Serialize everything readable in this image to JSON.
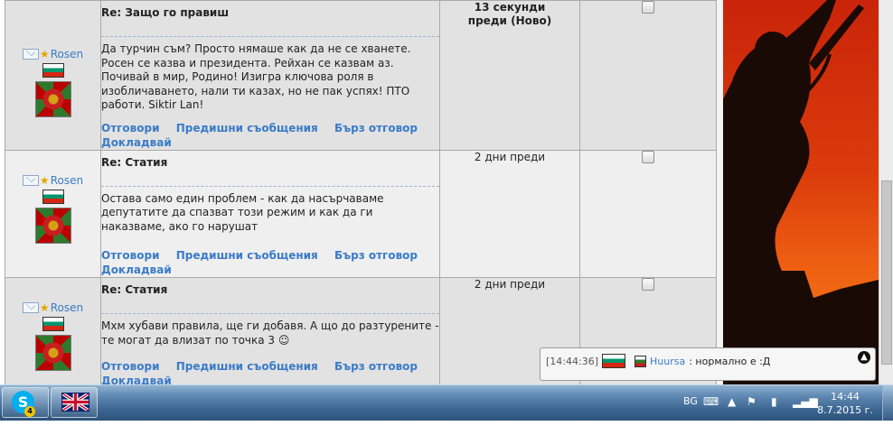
{
  "posts": [
    {
      "username": "Rosen",
      "subject": "Re: Защо го правиш",
      "body": "Да турчин съм? Просто нямаше как да не се хванете. Росен се казва и президента. Рейхан се казвам аз. Почивай в мир, Родино! Изигра ключова роля в изобличаването, нали ти казах, но не пак успях! ПТО работи. Siktir Lan!",
      "time": "13 секунди преди (Ново)",
      "time_bold": true
    },
    {
      "username": "Rosen",
      "subject": "Re: Статия",
      "body": "Остава само един проблем - как да насърчаваме депутатите да спазват този режим и как да ги наказваме, ако го нарушат",
      "time": "2 дни преди",
      "time_bold": false
    },
    {
      "username": "Rosen",
      "subject": "Re: Статия",
      "body": "Мхм хубави правила, ще ги добавя. А що до разтурените - те могат да влизат по точка 3 ☺",
      "time": "2 дни преди",
      "time_bold": false
    }
  ],
  "actions": {
    "reply": "Отговори",
    "previous": "Предишни съобщения",
    "quick_reply": "Бърз отговор",
    "report": "Докладвай"
  },
  "chat": {
    "time": "[14:44:36]",
    "user": "Huursa",
    "message": ": нормално е :Д"
  },
  "taskbar": {
    "skype_badge": "4",
    "language": "BG",
    "clock_time": "14:44",
    "clock_date": "8.7.2015 г."
  },
  "colors": {
    "link": "#3a7bc8",
    "taskbar": "#3b6590",
    "banner": "#db3b0c"
  }
}
